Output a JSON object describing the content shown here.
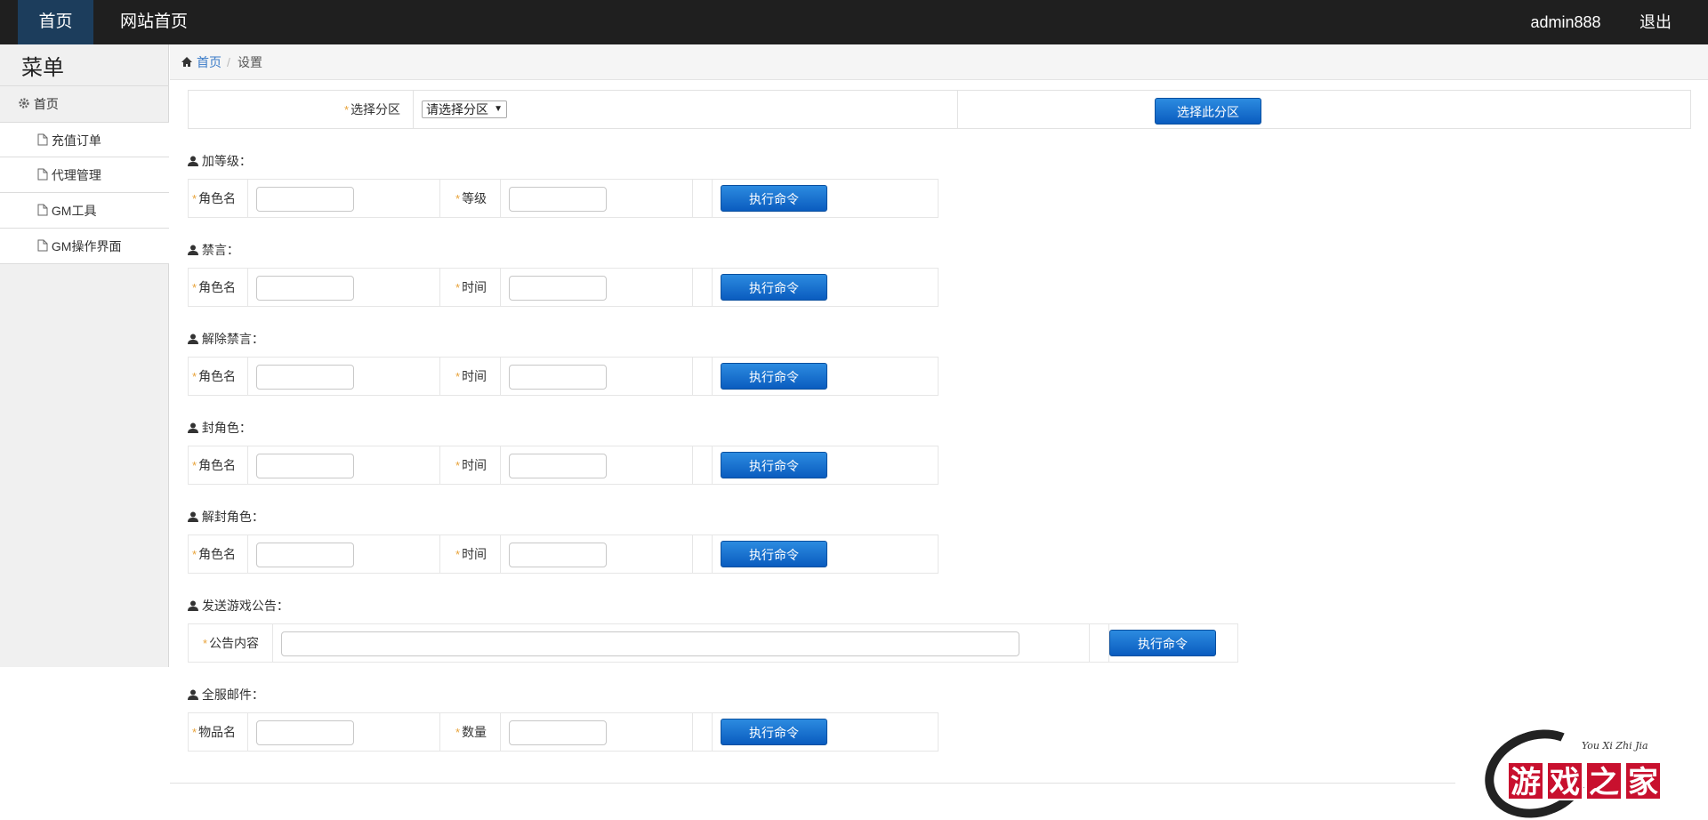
{
  "topbar": {
    "home": "首页",
    "site_home": "网站首页",
    "username": "admin888",
    "logout": "退出"
  },
  "sidebar": {
    "title": "菜单",
    "group": "首页",
    "items": [
      {
        "label": "充值订单"
      },
      {
        "label": "代理管理"
      },
      {
        "label": "GM工具"
      },
      {
        "label": "GM操作界面"
      }
    ]
  },
  "breadcrumb": {
    "home": "首页",
    "separator": "/",
    "current": "设置"
  },
  "partition": {
    "label": "选择分区",
    "select_value": "请选择分区",
    "button": "选择此分区"
  },
  "sections": [
    {
      "title": "加等级：",
      "field1": "角色名",
      "field2": "等级",
      "button": "执行命令"
    },
    {
      "title": "禁言：",
      "field1": "角色名",
      "field2": "时间",
      "button": "执行命令"
    },
    {
      "title": "解除禁言：",
      "field1": "角色名",
      "field2": "时间",
      "button": "执行命令"
    },
    {
      "title": "封角色：",
      "field1": "角色名",
      "field2": "时间",
      "button": "执行命令"
    },
    {
      "title": "解封角色：",
      "field1": "角色名",
      "field2": "时间",
      "button": "执行命令"
    }
  ],
  "announce": {
    "title": "发送游戏公告：",
    "label": "公告内容",
    "button": "执行命令"
  },
  "mail": {
    "title": "全服邮件：",
    "field1": "物品名",
    "field2": "数量",
    "button": "执行命令"
  },
  "logo": {
    "subtitle": "You Xi Zhi Jia",
    "chars": [
      "游",
      "戏",
      "之",
      "家"
    ]
  },
  "colors": {
    "topbar": "#1f1f1f",
    "nav_active": "#1c3d5c",
    "button": "#0a5cbf",
    "required_star": "#e8a33a",
    "logo_red": "#c8102e"
  }
}
